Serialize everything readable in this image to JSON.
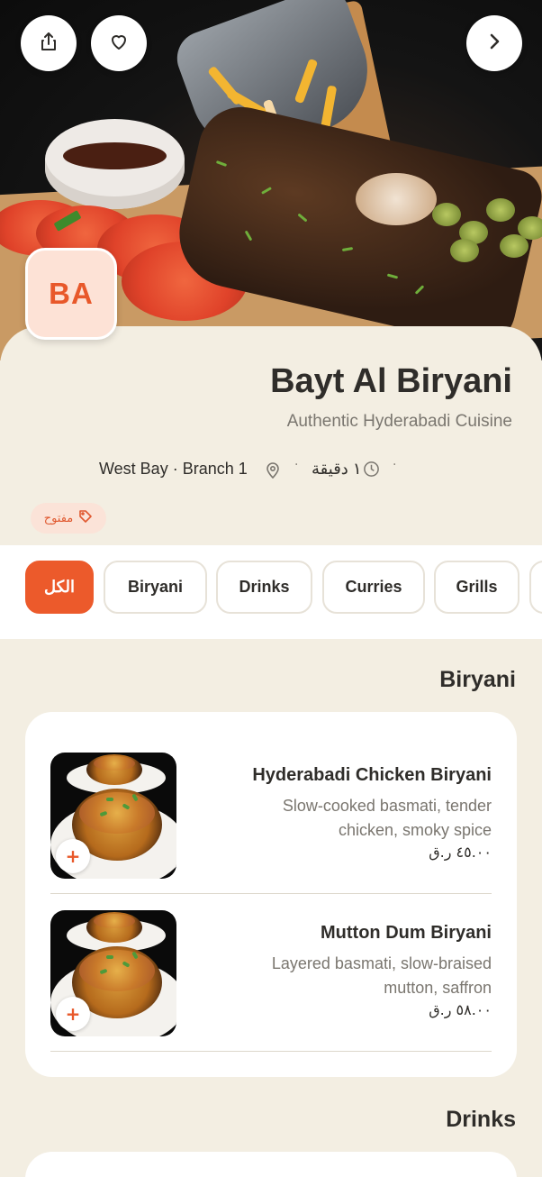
{
  "restaurant": {
    "logo_initials": "BA",
    "name": "Bayt Al Biryani",
    "tagline": "Authentic Hyderabadi Cuisine",
    "location": "West Bay · Branch 1",
    "time": "١ دقيقة",
    "status": "مفتوح"
  },
  "header": {
    "share_icon": "share-icon",
    "favorite_icon": "heart-icon",
    "back_icon": "chevron-right-icon"
  },
  "tabs": [
    {
      "label": "الكل",
      "active": true
    },
    {
      "label": "Biryani",
      "active": false
    },
    {
      "label": "Drinks",
      "active": false
    },
    {
      "label": "Curries",
      "active": false
    },
    {
      "label": "Grills",
      "active": false
    }
  ],
  "sections": [
    {
      "title": "Biryani",
      "items": [
        {
          "name": "Hyderabadi Chicken Biryani",
          "description": "Slow-cooked basmati, tender chicken, smoky spice",
          "price": "٤٥.٠٠ ر.ق"
        },
        {
          "name": "Mutton Dum Biryani",
          "description": "Layered basmati, slow-braised mutton, saffron",
          "price": "٥٨.٠٠ ر.ق"
        }
      ]
    },
    {
      "title": "Drinks",
      "items": []
    }
  ],
  "colors": {
    "accent": "#ec5a2b",
    "background": "#f3eee2",
    "card": "#ffffff",
    "text_primary": "#2f2d2a",
    "text_secondary": "#7a766f"
  }
}
